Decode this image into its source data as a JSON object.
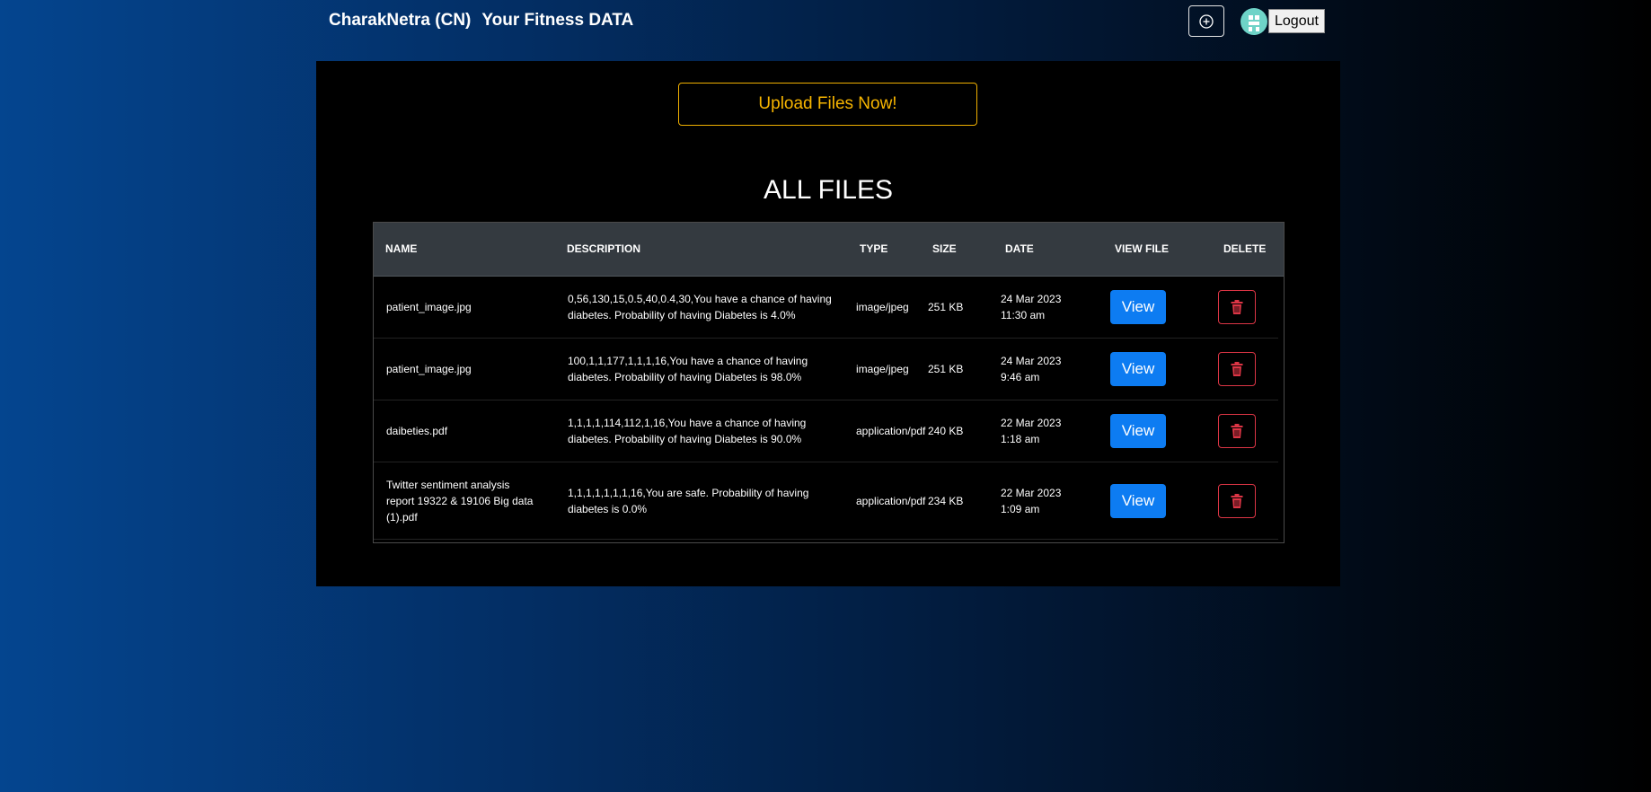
{
  "header": {
    "brand": "CharakNetra (CN)",
    "subtitle": "Your Fitness DATA",
    "add_icon": "plus-circle-icon",
    "avatar_icon": "user-avatar",
    "logout_label": "Logout"
  },
  "main": {
    "upload_label": "Upload Files Now!",
    "section_title": "ALL FILES",
    "table": {
      "headers": [
        "NAME",
        "DESCRIPTION",
        "TYPE",
        "SIZE",
        "DATE",
        "VIEW FILE",
        "DELETE"
      ],
      "rows": [
        {
          "name": [
            "patient_image.jpg"
          ],
          "description": [
            "0,56,130,15,0.5,40,0.4,30,You have a chance of having",
            "diabetes. Probability of having Diabetes is 4.0%"
          ],
          "type": "image/jpeg",
          "size": "251 KB",
          "date": [
            "24 Mar 2023",
            "11:30 am"
          ],
          "view_label": "View"
        },
        {
          "name": [
            "patient_image.jpg"
          ],
          "description": [
            "100,1,1,177,1,1,1,16,You have a chance of having",
            "diabetes. Probability of having Diabetes is 98.0%"
          ],
          "type": "image/jpeg",
          "size": "251 KB",
          "date": [
            "24 Mar 2023",
            "9:46 am"
          ],
          "view_label": "View"
        },
        {
          "name": [
            "daibeties.pdf"
          ],
          "description": [
            "1,1,1,1,114,112,1,16,You have a chance of having",
            "diabetes. Probability of having Diabetes is 90.0%"
          ],
          "type": "application/pdf",
          "size": "240 KB",
          "date": [
            "22 Mar 2023",
            "1:18 am"
          ],
          "view_label": "View"
        },
        {
          "name": [
            "Twitter sentiment analysis",
            "report 19322 & 19106 Big data",
            "(1).pdf"
          ],
          "description": [
            "1,1,1,1,1,1,1,16,You are safe. Probability of having",
            "diabetes is 0.0%"
          ],
          "type": "application/pdf",
          "size": "234 KB",
          "date": [
            "22 Mar 2023",
            "1:09 am"
          ],
          "view_label": "View"
        }
      ]
    },
    "colors": {
      "accent_gold": "#f7b500",
      "view_blue": "#0d7cf2",
      "delete_red": "#dc3545",
      "header_gray": "#343a40"
    },
    "icons": {
      "delete": "trash-icon"
    }
  }
}
